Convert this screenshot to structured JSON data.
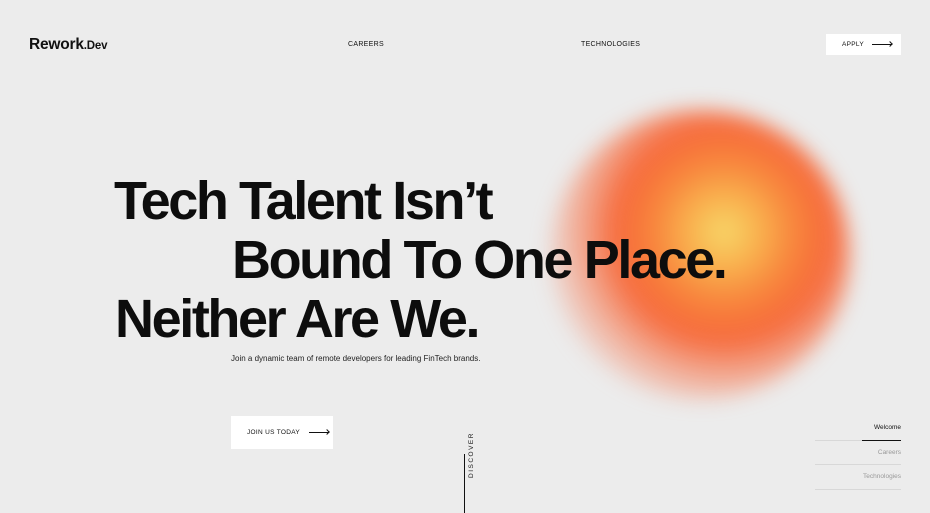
{
  "header": {
    "logo_main": "Rework",
    "logo_suffix": ".Dev",
    "nav": {
      "careers": "CAREERS",
      "technologies": "TECHNOLOGIES"
    },
    "apply_label": "APPLY"
  },
  "hero": {
    "line1": "Tech Talent Isn’t",
    "line2": "Bound To One Place.",
    "line3": "Neither Are We.",
    "subtitle": "Join a dynamic team of remote developers for leading FinTech brands.",
    "cta_label": "JOIN US TODAY"
  },
  "discover_label": "DISCOVER",
  "sidenav": {
    "items": [
      {
        "label": "Welcome"
      },
      {
        "label": "Careers"
      },
      {
        "label": "Technologies"
      }
    ]
  },
  "colors": {
    "background": "#ececec",
    "glow_core": "#f7d86a",
    "glow_outer": "#f66a3c",
    "text": "#111111"
  }
}
